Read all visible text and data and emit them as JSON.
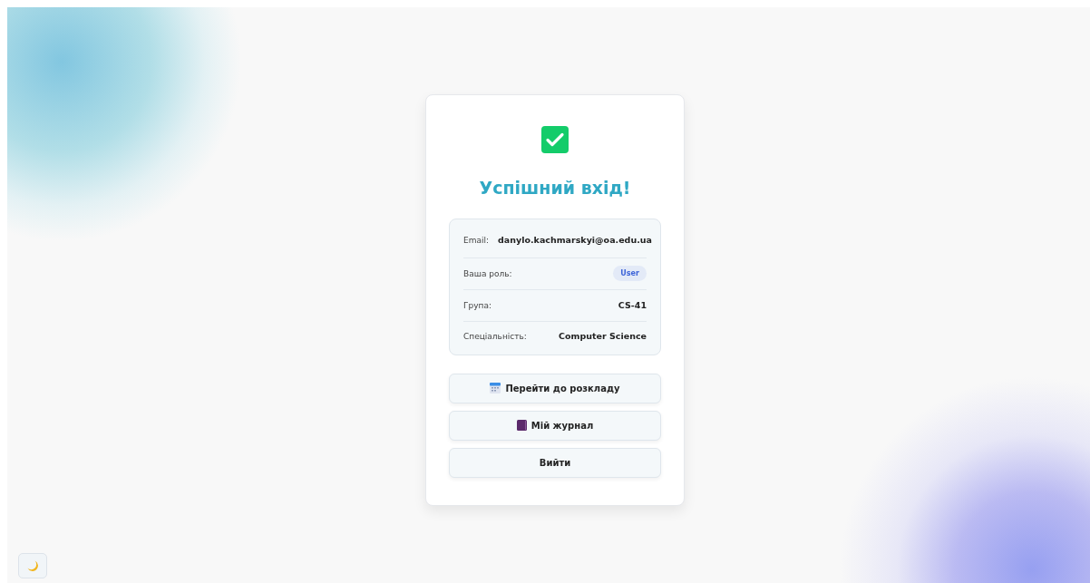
{
  "title": "Успішний вхід!",
  "details": [
    {
      "label": "Email:",
      "value": "danylo.kachmarskyi@oa.edu.ua",
      "kind": "text"
    },
    {
      "label": "Ваша роль:",
      "value": "User",
      "kind": "badge"
    },
    {
      "label": "Група:",
      "value": "CS-41",
      "kind": "text"
    },
    {
      "label": "Спеціальність:",
      "value": "Computer Science",
      "kind": "text"
    }
  ],
  "buttons": [
    {
      "label": "Перейти до розкладу",
      "kind": "calendar"
    },
    {
      "label": "Мій журнал",
      "kind": "book"
    },
    {
      "label": "Вийти",
      "kind": "plain"
    }
  ]
}
